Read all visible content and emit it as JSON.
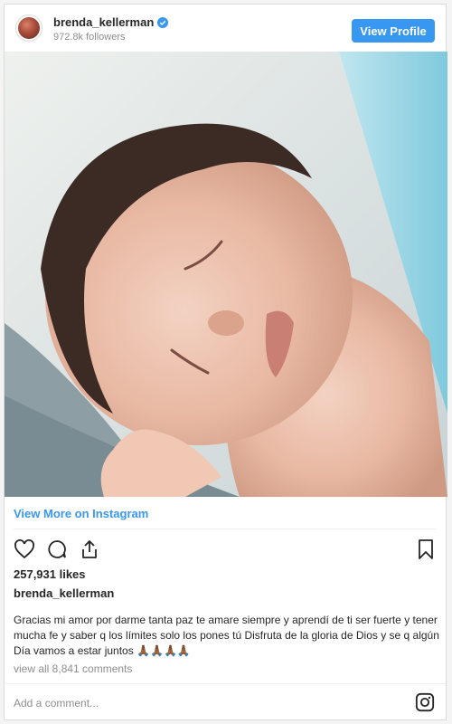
{
  "header": {
    "username": "brenda_kellerman",
    "followers": "972.8k followers",
    "view_profile_label": "View Profile"
  },
  "post": {
    "view_more_label": "View More on Instagram",
    "likes": "257,931 likes",
    "owner": "brenda_kellerman",
    "caption": "Gracias mi amor por darme tanta paz te amare siempre y aprendí de ti ser fuerte y tener mucha fe y saber q los límites solo los pones tú Disfruta de la gloria de Dios y se q algún Día vamos a estar juntos 🙏🏾🙏🏾🙏🏾🙏🏾",
    "comments_label": "view all 8,841 comments",
    "add_comment_placeholder": "Add a comment..."
  },
  "icons": {
    "verified": "verified-badge-icon",
    "like": "heart-icon",
    "comment": "comment-icon",
    "share": "share-icon",
    "save": "bookmark-icon",
    "instagram": "instagram-icon"
  },
  "colors": {
    "accent": "#3897f0",
    "text": "#262626",
    "muted": "#8e8e8e"
  }
}
